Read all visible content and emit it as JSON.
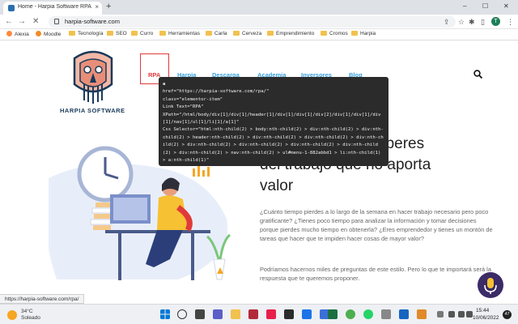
{
  "browser": {
    "tab_title": "Home - Harpia Software RPA",
    "tab_close": "×",
    "new_tab": "+",
    "min": "–",
    "max": "☐",
    "close": "✕",
    "back": "←",
    "forward": "→",
    "reload": "✕",
    "url": "harpia-software.com",
    "profile_initial": "T"
  },
  "bookmarks": [
    "Alexia",
    "Moodle",
    "Tecnología",
    "SEO",
    "Curro",
    "Herramientas",
    "Carla",
    "Cerveza",
    "Emprendimiento",
    "Cromos",
    "Harpia"
  ],
  "site": {
    "logo_text": "HARPIA SOFTWARE",
    "menu": [
      "RPA",
      "Harpia",
      "Descarga",
      "Academia",
      "Inversores",
      "Blog"
    ],
    "headline_line1": "te liberes",
    "headline_line2": "del trabajo que no aporta",
    "headline_line3": "valor",
    "paragraph1": "¿Cuánto tiempo pierdes a lo largo de la semana en hacer trabajo necesario pero poco gratificante? ¿Tienes poco tiempo para analizar la información y tomar decisiones porque pierdes mucho tiempo en obtenerla? ¿Eres emprendedor y tienes un montón de tareas que hacer que te impiden hacer cosas de mayor valor?",
    "paragraph2": "Podríamos hacernos miles de preguntas de este estilo. Pero lo que te importará será la respuesta que te queremos proponer."
  },
  "inspector": {
    "tag": "a",
    "href": "href=\"https://harpia-software.com/rpa/\"",
    "class": "class=\"elementor-item\"",
    "link_text": "Link Text=\"RPA\"",
    "xpath": "XPath=\"/html/body/div[1]/div[1]/header[1]/div[1]/div[1]/div[2]/div[1]/div[1]/div[1]/nav[1]/ul[1]/li[1]/a[1]\"",
    "css_selector": "Css Selector=\"html:nth-child(2) > body:nth-child(2) > div:nth-child(2) > div:nth-child(2) > header:nth-child(2) > div:nth-child(2) > div:nth-child(2) > div:nth-child(2) > div:nth-child(2) > div:nth-child(2) > div:nth-child(2) > div:nth-child(2) > div:nth-child(2) > nav:nth-child(2) > ul#menu-1-882abbd1 > li:nth-child(1) > a:nth-child(1)\""
  },
  "status_url": "https://harpia-software.com/rpa/",
  "taskbar": {
    "temp": "34°C",
    "weather": "Soleado",
    "time": "15:44",
    "date": "10/06/2022",
    "notifications": "47"
  },
  "colors": {
    "menu_link": "#3aa0d8",
    "rpa_highlight": "#e03a3a",
    "inspector_bg": "#2b2b2b",
    "logo_navy": "#1a3a5a"
  }
}
